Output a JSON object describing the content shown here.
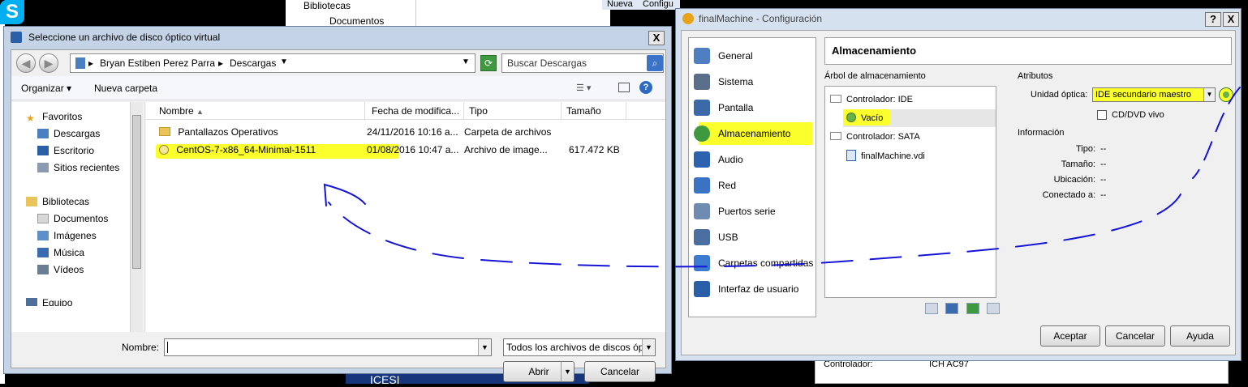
{
  "background": {
    "skype_glyph": "S",
    "explorer_items": [
      "Bibliotecas",
      "Documentos"
    ],
    "menu_items": [
      "Nueva",
      "Configu"
    ],
    "bottom_right": {
      "label": "Controlador:",
      "value": "ICH AC97"
    }
  },
  "open_dialog": {
    "title": "Seleccione un archivo de disco óptico virtual",
    "close_glyph": "X",
    "breadcrumb": [
      "Bryan Estiben Perez Parra",
      "Descargas"
    ],
    "search_placeholder": "Buscar Descargas",
    "toolbar": {
      "organize": "Organizar ▾",
      "new_folder": "Nueva carpeta"
    },
    "nav": {
      "favorites_header": "Favoritos",
      "favorites": [
        "Descargas",
        "Escritorio",
        "Sitios recientes"
      ],
      "libraries_header": "Bibliotecas",
      "libraries": [
        "Documentos",
        "Imágenes",
        "Música",
        "Vídeos"
      ],
      "computer": "Equipo"
    },
    "columns": [
      "Nombre",
      "Fecha de modifica...",
      "Tipo",
      "Tamaño"
    ],
    "files": [
      {
        "name": "Pantallazos Operativos",
        "date": "24/11/2016 10:16 a...",
        "type": "Carpeta de archivos",
        "size": ""
      },
      {
        "name": "CentOS-7-x86_64-Minimal-1511",
        "date": "01/08/2016 10:47 a...",
        "type": "Archivo de image...",
        "size": "617.472 KB"
      }
    ],
    "filename_label": "Nombre:",
    "filename_value": "",
    "filter": "Todos los archivos de discos óp",
    "open_button": "Abrir",
    "cancel_button": "Cancelar"
  },
  "config_dialog": {
    "title": "finalMachine - Configuración",
    "help_glyph": "?",
    "close_glyph": "X",
    "categories": [
      "General",
      "Sistema",
      "Pantalla",
      "Almacenamiento",
      "Audio",
      "Red",
      "Puertos serie",
      "USB",
      "Carpetas compartidas",
      "Interfaz de usuario"
    ],
    "selected_category": "Almacenamiento",
    "section_title": "Almacenamiento",
    "tree_label": "Árbol de almacenamiento",
    "tree": {
      "ide_controller": "Controlador: IDE",
      "ide_child": "Vacío",
      "sata_controller": "Controlador: SATA",
      "sata_child": "finalMachine.vdi"
    },
    "attributes_label": "Atributos",
    "optical_label": "Unidad óptica:",
    "optical_value": "IDE secundario maestro",
    "live_cd_label": "CD/DVD vivo",
    "info_label": "Información",
    "info": [
      {
        "label": "Tipo:",
        "value": "--"
      },
      {
        "label": "Tamaño:",
        "value": "--"
      },
      {
        "label": "Ubicación:",
        "value": "--"
      },
      {
        "label": "Conectado a:",
        "value": "--"
      }
    ],
    "buttons": {
      "accept": "Aceptar",
      "cancel": "Cancelar",
      "help": "Ayuda"
    }
  },
  "colors": {
    "highlight": "#fbff2b",
    "annotation": "#1515d6",
    "title_bar": "#c4d3e6"
  }
}
